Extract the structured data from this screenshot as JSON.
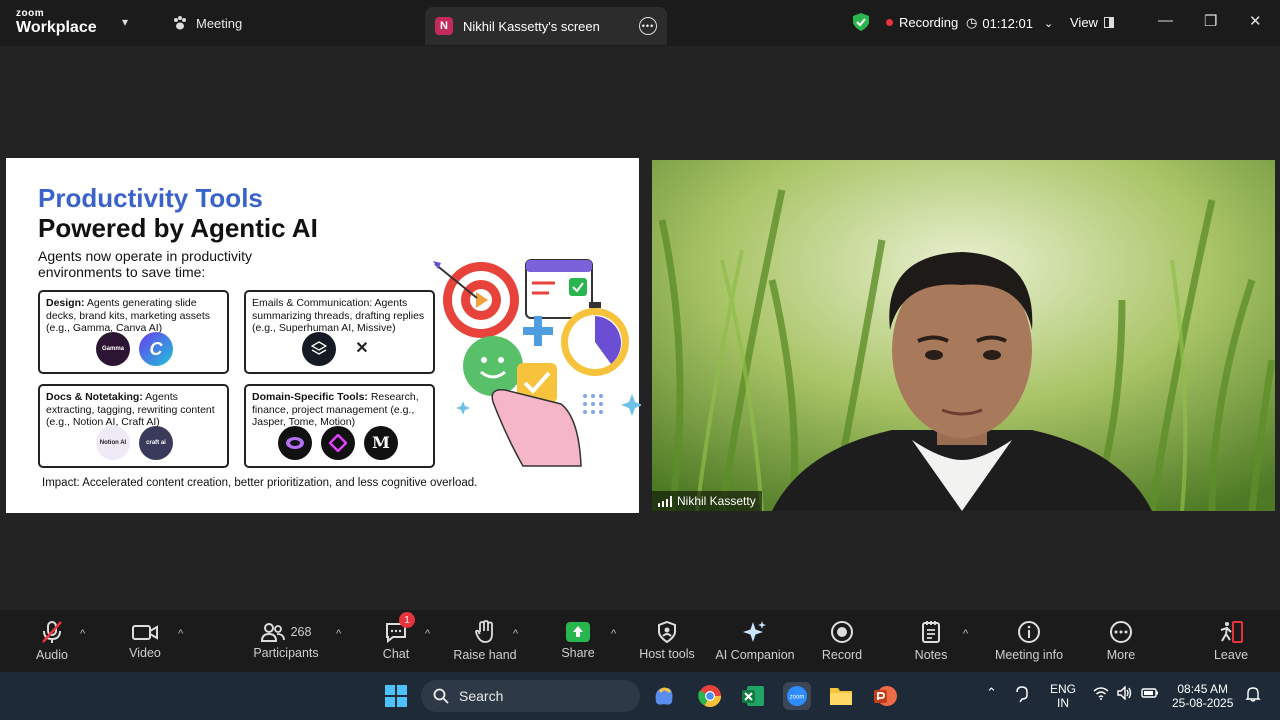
{
  "app": {
    "brand_top": "zoom",
    "brand_bottom": "Workplace",
    "meeting_label": "Meeting"
  },
  "screen_tab": {
    "badge": "N",
    "title": "Nikhil Kassetty's screen"
  },
  "status": {
    "recording": "Recording",
    "timer": "01:12:01",
    "view": "View"
  },
  "slide": {
    "title_line1": "Productivity Tools",
    "title_line2": "Powered by Agentic AI",
    "intro": "Agents now operate in productivity environments to save time:",
    "cards": [
      {
        "head": "Design:",
        "body": " Agents generating slide decks, brand kits, marketing assets (e.g., Gamma, Canva AI)",
        "logos": [
          "Gamma",
          "C"
        ]
      },
      {
        "head": "",
        "body": "Emails & Communication: Agents summarizing threads, drafting replies (e.g., Superhuman AI, Missive)",
        "logos": [
          "",
          ""
        ]
      },
      {
        "head": "Docs & Notetaking:",
        "body": " Agents extracting, tagging, rewriting content (e.g., Notion AI, Craft AI)",
        "logos": [
          "Notion AI",
          "craft ai"
        ]
      },
      {
        "head": "Domain-Specific Tools:",
        "body": " Research, finance, project management (e.g., Jasper, Tome, Motion)",
        "logos": [
          "",
          "",
          "M"
        ]
      }
    ],
    "impact": "Impact: Accelerated content creation, better prioritization, and less cognitive overload."
  },
  "video": {
    "participant_name": "Nikhil Kassetty"
  },
  "toolbar": {
    "audio": "Audio",
    "video": "Video",
    "participants": "Participants",
    "participants_count": "268",
    "chat": "Chat",
    "chat_badge": "1",
    "raise_hand": "Raise hand",
    "share": "Share",
    "host_tools": "Host tools",
    "ai_companion": "AI Companion",
    "record": "Record",
    "notes": "Notes",
    "meeting_info": "Meeting info",
    "more": "More",
    "leave": "Leave"
  },
  "taskbar": {
    "search_placeholder": "Search",
    "lang_top": "ENG",
    "lang_bottom": "IN",
    "time": "08:45 AM",
    "date": "25-08-2025"
  },
  "colors": {
    "accent_blue": "#3a63c9",
    "recording_red": "#e8323c",
    "share_green": "#2ab64e",
    "topbar": "#1b1b1b",
    "taskbar": "#1f2a38"
  }
}
